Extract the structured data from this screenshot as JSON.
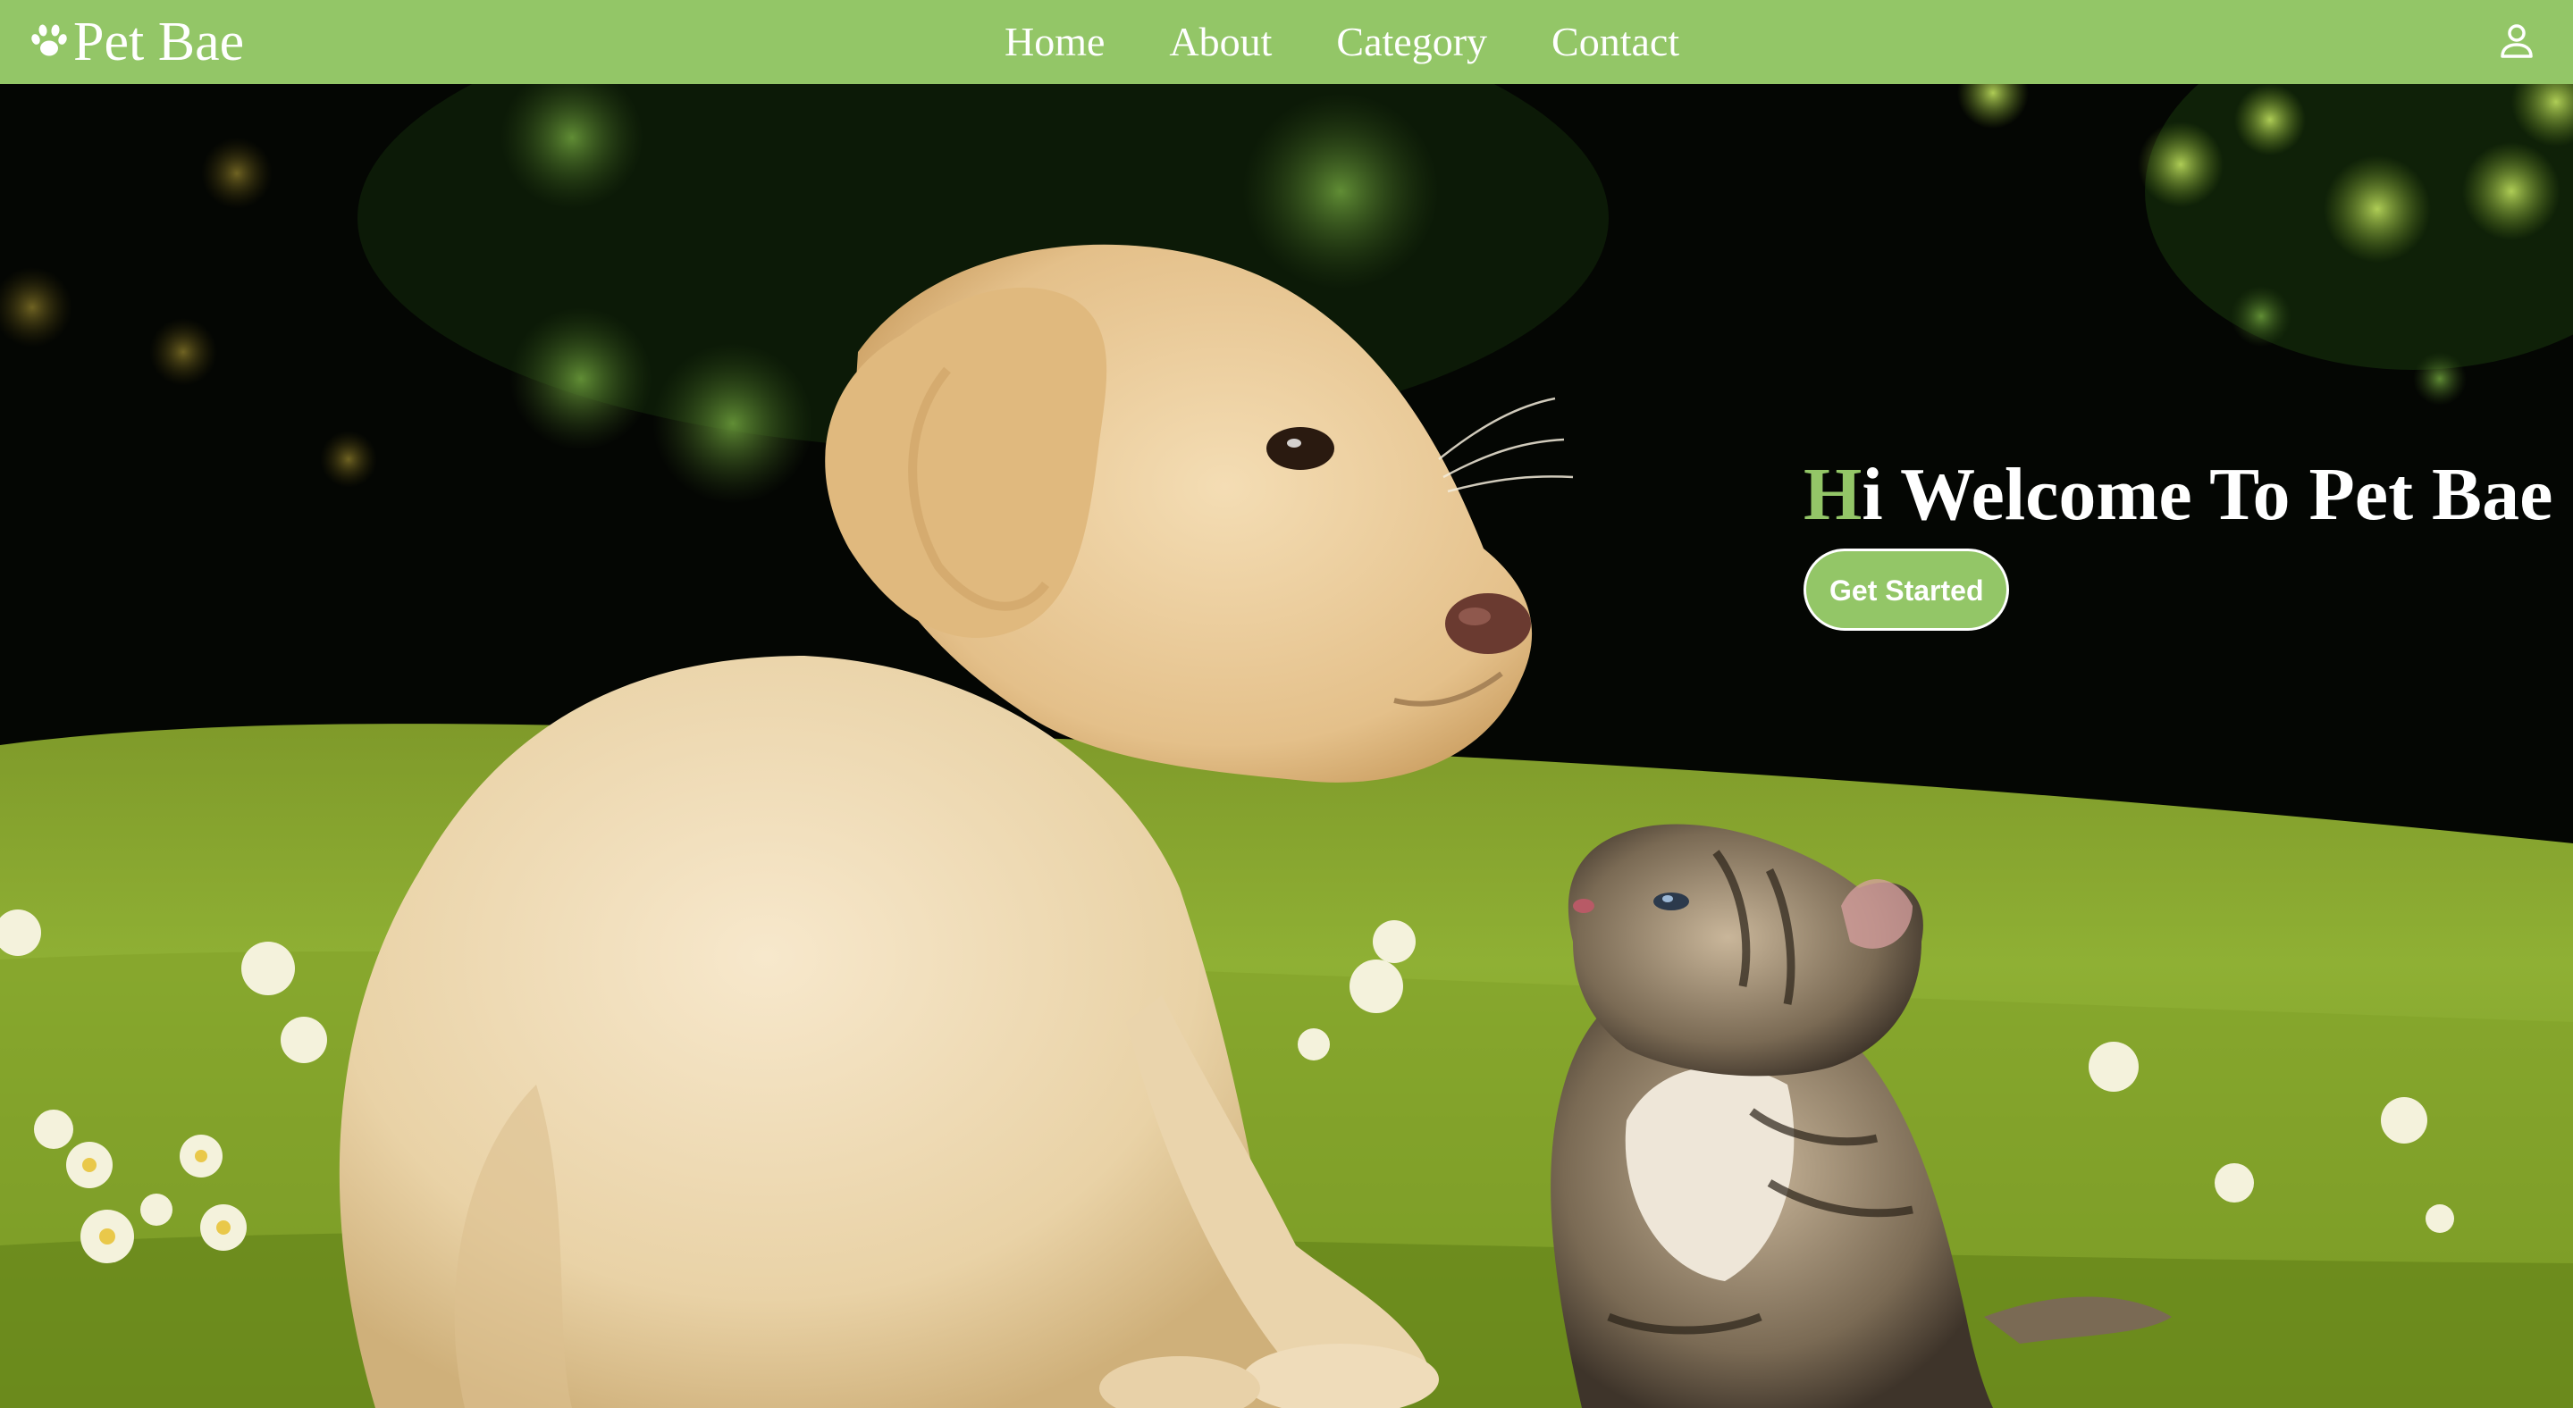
{
  "colors": {
    "brand_green": "#93c667",
    "text_white": "#ffffff"
  },
  "header": {
    "brand": {
      "icon": "paw-icon",
      "name": "Pet Bae"
    },
    "nav": [
      {
        "label": "Home"
      },
      {
        "label": "About"
      },
      {
        "label": "Category"
      },
      {
        "label": "Contact"
      }
    ],
    "user_icon": "user-icon"
  },
  "hero": {
    "title_accent": "H",
    "title_rest": "i Welcome To Pet Bae",
    "cta_label": "Get Started"
  }
}
